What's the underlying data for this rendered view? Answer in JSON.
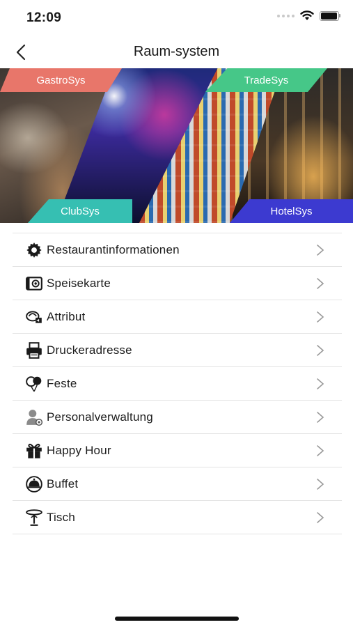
{
  "status_bar": {
    "time": "12:09"
  },
  "nav": {
    "title": "Raum-system"
  },
  "banner": {
    "tags": [
      "GastroSys",
      "ClubSys",
      "TradeSys",
      "HotelSys"
    ]
  },
  "menu": {
    "items": [
      {
        "label": "Restaurantinformationen",
        "icon": "gear-icon"
      },
      {
        "label": "Speisekarte",
        "icon": "menu-card-icon"
      },
      {
        "label": "Attribut",
        "icon": "attribute-icon"
      },
      {
        "label": "Druckeradresse",
        "icon": "printer-icon"
      },
      {
        "label": "Feste",
        "icon": "balloons-icon"
      },
      {
        "label": "Personalverwaltung",
        "icon": "staff-icon"
      },
      {
        "label": "Happy Hour",
        "icon": "gift-icon"
      },
      {
        "label": "Buffet",
        "icon": "buffet-icon"
      },
      {
        "label": "Tisch",
        "icon": "table-icon"
      }
    ]
  }
}
